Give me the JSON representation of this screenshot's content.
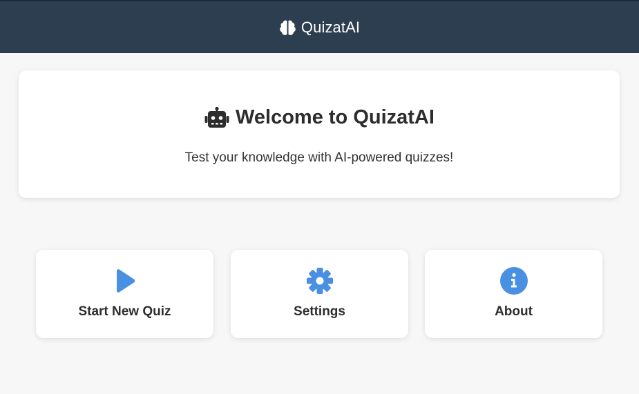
{
  "header": {
    "title": "QuizatAI",
    "icon": "brain-icon",
    "background": "#2c3e50"
  },
  "welcome": {
    "title": "Welcome to QuizatAI",
    "icon": "robot-icon",
    "subtitle": "Test your knowledge with AI-powered quizzes!"
  },
  "actions": [
    {
      "label": "Start New Quiz",
      "icon": "play-icon"
    },
    {
      "label": "Settings",
      "icon": "gear-icon"
    },
    {
      "label": "About",
      "icon": "info-icon"
    }
  ],
  "colors": {
    "accent": "#4a90e2",
    "page_background": "#f7f7f7",
    "card_background": "#ffffff",
    "text": "#2d2d2d"
  }
}
